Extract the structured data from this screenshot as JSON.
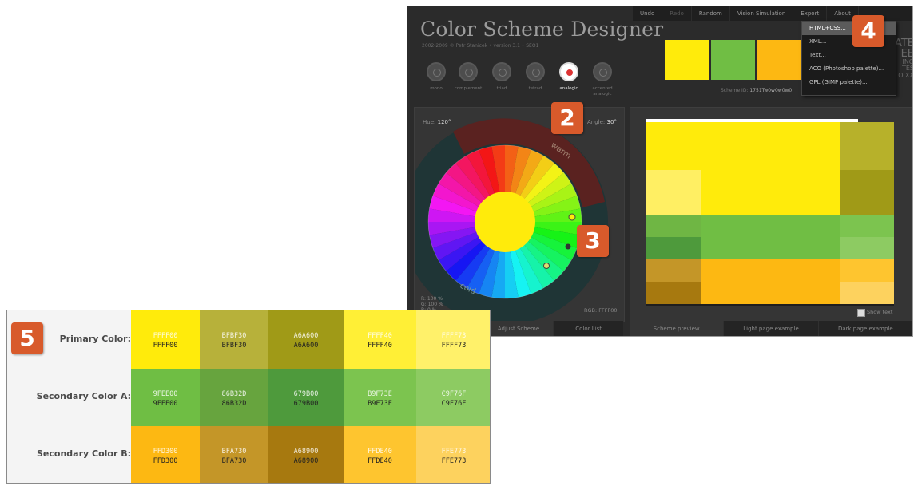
{
  "app": {
    "title": "Color Scheme Designer",
    "subtitle": "2002-2009 © Petr Stanicek • version 3.1 • SEO1",
    "modes": [
      {
        "label": "mono",
        "active": false
      },
      {
        "label": "complement",
        "active": false
      },
      {
        "label": "triad",
        "active": false
      },
      {
        "label": "tetrad",
        "active": false
      },
      {
        "label": "analogic",
        "active": true
      },
      {
        "label": "accented analogic",
        "active": false
      }
    ],
    "toolbar": [
      "Undo",
      "Redo",
      "Random",
      "Vision Simulation",
      "Export",
      "About"
    ],
    "export_menu": [
      "HTML+CSS...",
      "XML...",
      "Text...",
      "ACO (Photoshop palette)...",
      "GPL (GIMP palette)..."
    ],
    "scheme_id_label": "Scheme ID:",
    "scheme_id_value": "1751Tw0w0w0w0",
    "right_text": [
      "ATE",
      "EE",
      "ING",
      "TES",
      "O XX"
    ],
    "hue_label": "Hue:",
    "hue_value": "120°",
    "angle_label": "Angle:",
    "angle_value": "30°",
    "warm_label": "warm",
    "cold_label": "cold",
    "rgb_values": [
      "R: 100 %",
      "G: 100 %",
      "B:   0 %"
    ],
    "rgb_hex": "RGB: FFFF00",
    "show_text": "Show text",
    "left_tabs": [
      "Adjust Scheme",
      "Color List"
    ],
    "preview_tabs": [
      "Scheme preview",
      "Light page example",
      "Dark page example"
    ],
    "colors": {
      "primary": "#FFFF00",
      "secondary_a": "#6FC13A",
      "secondary_b": "#FDC100",
      "olive": "#B7B32C",
      "dark_olive": "#A09A0F"
    }
  },
  "badges": [
    "2",
    "3",
    "4",
    "5"
  ],
  "table": {
    "rows": [
      {
        "label": "Primary Color:",
        "cells": [
          {
            "hex": "FFFF00",
            "color": "#FFEB0B"
          },
          {
            "hex": "BFBF30",
            "color": "#B7B13A"
          },
          {
            "hex": "A6A600",
            "color": "#A09A17"
          },
          {
            "hex": "FFFF40",
            "color": "#FFEF36"
          },
          {
            "hex": "FFFF73",
            "color": "#FFF16A"
          }
        ]
      },
      {
        "label": "Secondary Color A:",
        "cells": [
          {
            "hex": "9FEE00",
            "color": "#6FBE44"
          },
          {
            "hex": "86B32D",
            "color": "#67A43E"
          },
          {
            "hex": "679B00",
            "color": "#4E9A3C"
          },
          {
            "hex": "B9F73E",
            "color": "#7CC44F"
          },
          {
            "hex": "C9F76F",
            "color": "#8DCB62"
          }
        ]
      },
      {
        "label": "Secondary Color B:",
        "cells": [
          {
            "hex": "FFD300",
            "color": "#FDB812"
          },
          {
            "hex": "BFA730",
            "color": "#C49628"
          },
          {
            "hex": "A68900",
            "color": "#A7790F"
          },
          {
            "hex": "FFDE40",
            "color": "#FEC52F"
          },
          {
            "hex": "FFE773",
            "color": "#FDD25E"
          }
        ]
      }
    ]
  }
}
